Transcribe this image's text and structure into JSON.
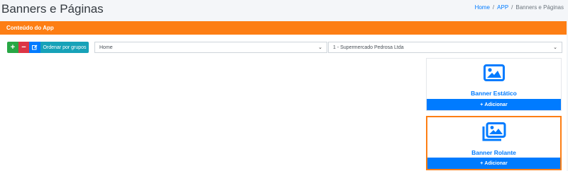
{
  "page": {
    "title": "Banners e Páginas"
  },
  "breadcrumb": [
    "Home",
    "APP",
    "Banners e Páginas"
  ],
  "panel": {
    "header": "Conteúdo do App"
  },
  "toolbar": {
    "add_icon": "+",
    "remove_icon": "−",
    "order_label": "Ordenar por grupos"
  },
  "selects": {
    "page_value": "Home",
    "company_value": "1 - Supermercado Pedrosa Ltda"
  },
  "cards": [
    {
      "title": "Banner Estático",
      "button_label": "Adicionar",
      "icon": "image-icon"
    },
    {
      "title": "Banner Rolante",
      "button_label": "Adicionar",
      "icon": "images-icon"
    }
  ],
  "colors": {
    "accent": "#fd7e14",
    "primary": "#007bff",
    "success": "#28a745",
    "danger": "#dc3545",
    "info": "#17a2b8"
  }
}
